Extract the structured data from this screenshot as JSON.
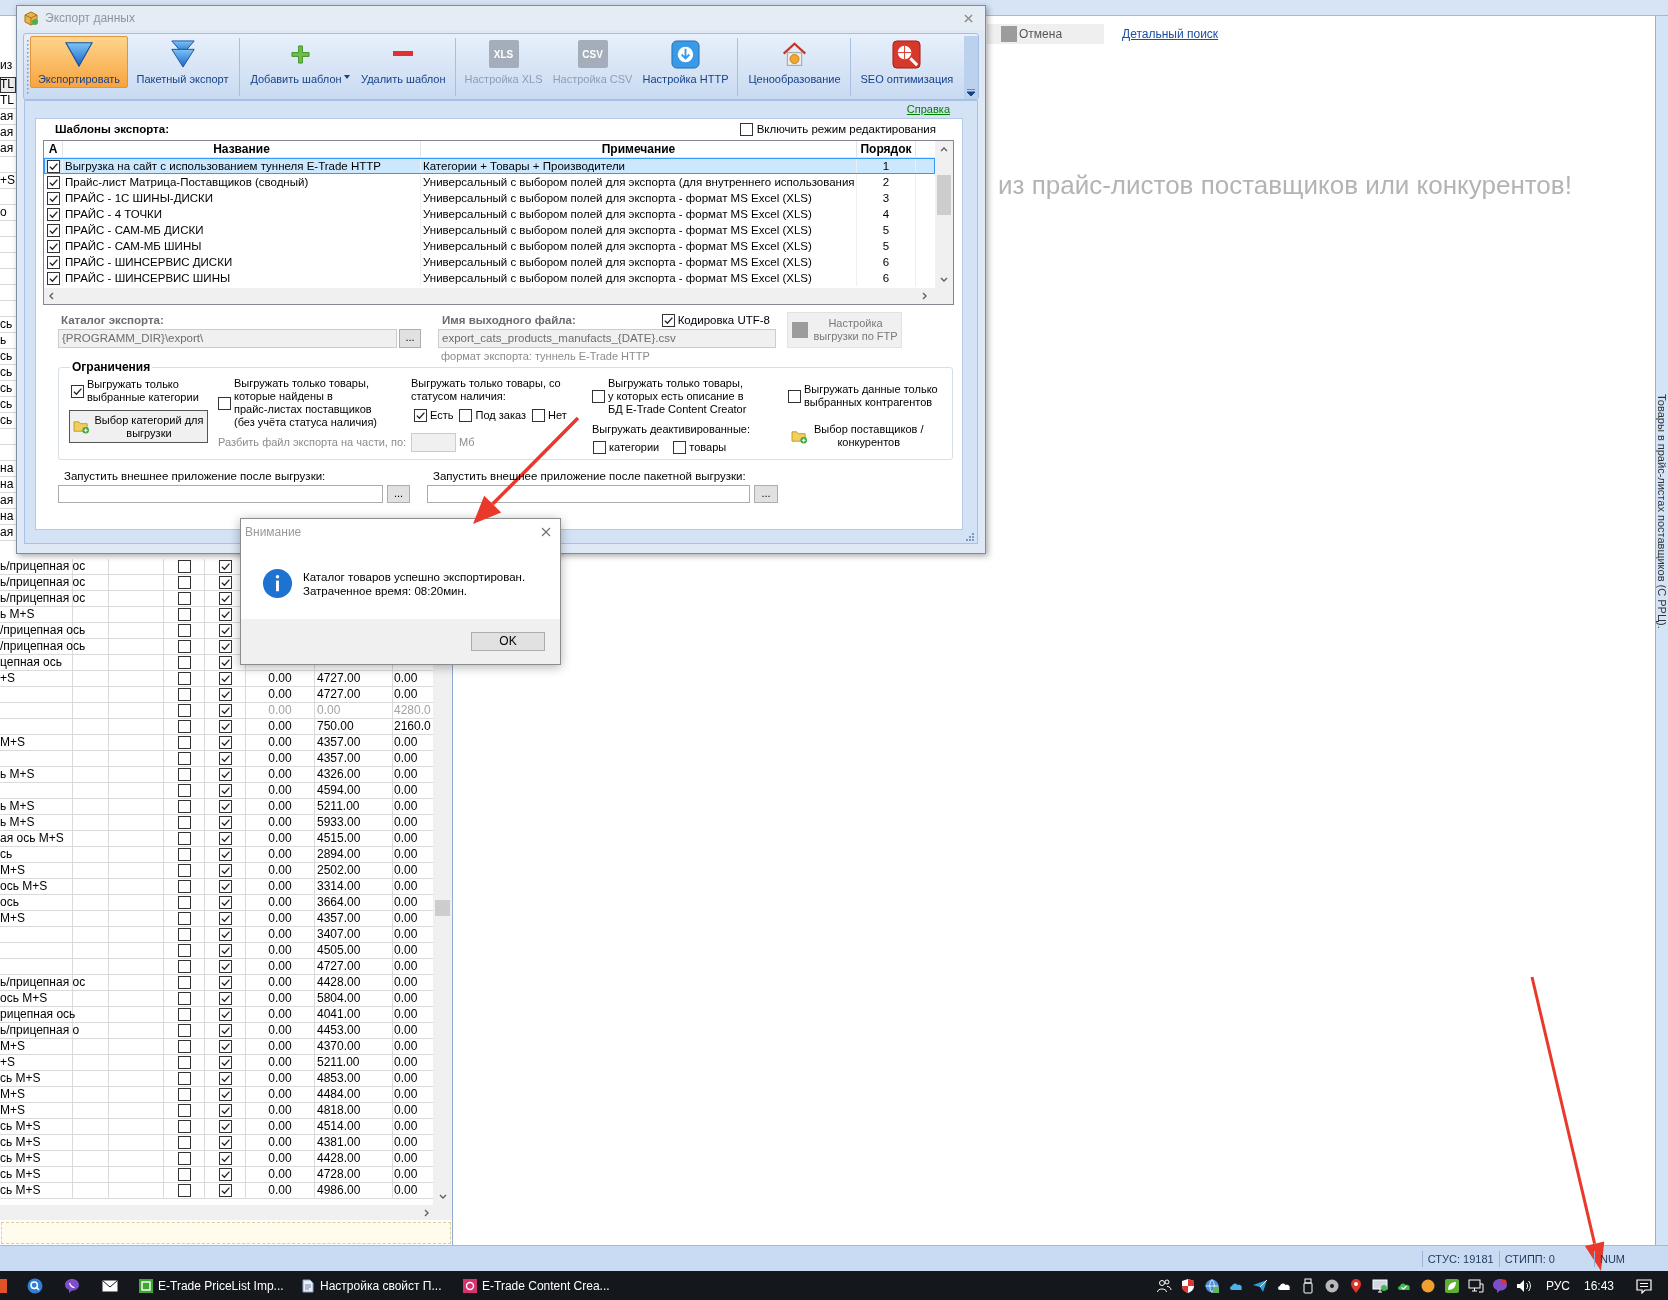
{
  "app": {
    "header_fragment": "из",
    "row_fragments": [
      {
        "column_1": "TL",
        "selected": true
      },
      {
        "column_1": "TL",
        "selected": false
      },
      {
        "column_1": "ая",
        "selected": false
      },
      {
        "column_1": "ая",
        "selected": false
      },
      {
        "column_1": "ая",
        "selected": false
      },
      {
        "selected": false
      },
      {
        "column_1": "+S",
        "selected": false
      },
      {
        "selected": false
      },
      {
        "column_1": "о",
        "selected": false
      },
      {
        "selected": false
      },
      {
        "selected": false
      },
      {
        "selected": false
      },
      {
        "selected": false
      },
      {
        "selected": false
      },
      {
        "selected": false
      },
      {
        "column_1": "сь",
        "selected": false
      },
      {
        "column_1": "ь",
        "selected": false
      },
      {
        "column_1": "сь",
        "selected": false
      },
      {
        "column_1": "сь",
        "selected": false
      },
      {
        "column_1": "сь",
        "selected": false
      },
      {
        "column_1": "сь",
        "selected": false
      },
      {
        "column_1": "сь",
        "selected": false
      },
      {
        "selected": false
      },
      {
        "selected": false
      },
      {
        "column_1": "на",
        "selected": false
      },
      {
        "column_1": "на",
        "selected": false
      },
      {
        "column_1": "ая",
        "selected": false
      },
      {
        "column_1": "на",
        "selected": false
      },
      {
        "column_1": "ая",
        "selected": false
      }
    ],
    "grid": {
      "rows": [
        {
          "column_1": "ь/прицепная ос",
          "checks": [
            false,
            true
          ],
          "disabled": false
        },
        {
          "column_1": "ь/прицепная ос",
          "checks": [
            false,
            true
          ],
          "disabled": false
        },
        {
          "column_1": "ь/прицепная ос",
          "checks": [
            false,
            true
          ],
          "disabled": false
        },
        {
          "column_1": "ь M+S",
          "checks": [
            false,
            true
          ],
          "disabled": false
        },
        {
          "column_1": "/прицепная ось",
          "checks": [
            false,
            true
          ],
          "disabled": false
        },
        {
          "column_1": "/прицепная ось",
          "checks": [
            false,
            true
          ],
          "disabled": false
        },
        {
          "column_1": "цепная ось",
          "checks": [
            false,
            true
          ],
          "disabled": false
        },
        {
          "column_1": "+S",
          "checks": [
            false,
            true
          ],
          "disabled": false,
          "values": [
            "0.00",
            "4727.00",
            "0.00"
          ]
        },
        {
          "checks": [
            false,
            true
          ],
          "disabled": false,
          "values": [
            "0.00",
            "4727.00",
            "0.00"
          ]
        },
        {
          "checks": [
            false,
            true
          ],
          "disabled": true,
          "values": [
            "0.00",
            "0.00",
            "4280.0"
          ]
        },
        {
          "checks": [
            false,
            true
          ],
          "disabled": false,
          "values": [
            "0.00",
            "750.00",
            "2160.0"
          ]
        },
        {
          "column_1": "M+S",
          "checks": [
            false,
            true
          ],
          "disabled": false,
          "values": [
            "0.00",
            "4357.00",
            "0.00"
          ]
        },
        {
          "checks": [
            false,
            true
          ],
          "disabled": false,
          "values": [
            "0.00",
            "4357.00",
            "0.00"
          ]
        },
        {
          "column_1": "ь M+S",
          "checks": [
            false,
            true
          ],
          "disabled": false,
          "values": [
            "0.00",
            "4326.00",
            "0.00"
          ]
        },
        {
          "checks": [
            false,
            true
          ],
          "disabled": false,
          "values": [
            "0.00",
            "4594.00",
            "0.00"
          ]
        },
        {
          "column_1": "ь M+S",
          "checks": [
            false,
            true
          ],
          "disabled": false,
          "values": [
            "0.00",
            "5211.00",
            "0.00"
          ]
        },
        {
          "column_1": "ь M+S",
          "checks": [
            false,
            true
          ],
          "disabled": false,
          "values": [
            "0.00",
            "5933.00",
            "0.00"
          ]
        },
        {
          "column_1": "ая ось M+S",
          "checks": [
            false,
            true
          ],
          "disabled": false,
          "values": [
            "0.00",
            "4515.00",
            "0.00"
          ]
        },
        {
          "column_1": "сь",
          "checks": [
            false,
            true
          ],
          "disabled": false,
          "values": [
            "0.00",
            "2894.00",
            "0.00"
          ]
        },
        {
          "column_1": "M+S",
          "checks": [
            false,
            true
          ],
          "disabled": false,
          "values": [
            "0.00",
            "2502.00",
            "0.00"
          ]
        },
        {
          "column_1": "ось M+S",
          "checks": [
            false,
            true
          ],
          "disabled": false,
          "values": [
            "0.00",
            "3314.00",
            "0.00"
          ]
        },
        {
          "column_1": "ось",
          "checks": [
            false,
            true
          ],
          "disabled": false,
          "values": [
            "0.00",
            "3664.00",
            "0.00"
          ]
        },
        {
          "column_1": "M+S",
          "checks": [
            false,
            true
          ],
          "disabled": false,
          "values": [
            "0.00",
            "4357.00",
            "0.00"
          ]
        },
        {
          "checks": [
            false,
            true
          ],
          "disabled": false,
          "values": [
            "0.00",
            "3407.00",
            "0.00"
          ]
        },
        {
          "checks": [
            false,
            true
          ],
          "disabled": false,
          "values": [
            "0.00",
            "4505.00",
            "0.00"
          ]
        },
        {
          "checks": [
            false,
            true
          ],
          "disabled": false,
          "values": [
            "0.00",
            "4727.00",
            "0.00"
          ]
        },
        {
          "column_1": "ь/прицепная ос",
          "checks": [
            false,
            true
          ],
          "disabled": false,
          "values": [
            "0.00",
            "4428.00",
            "0.00"
          ]
        },
        {
          "column_1": "ось M+S",
          "checks": [
            false,
            true
          ],
          "disabled": false,
          "values": [
            "0.00",
            "5804.00",
            "0.00"
          ]
        },
        {
          "column_1": "рицепная ось",
          "checks": [
            false,
            true
          ],
          "disabled": false,
          "values": [
            "0.00",
            "4041.00",
            "0.00"
          ]
        },
        {
          "column_1": "ь/прицепная о",
          "checks": [
            false,
            true
          ],
          "disabled": false,
          "values": [
            "0.00",
            "4453.00",
            "0.00"
          ]
        },
        {
          "column_1": "M+S",
          "checks": [
            false,
            true
          ],
          "disabled": false,
          "values": [
            "0.00",
            "4370.00",
            "0.00"
          ]
        },
        {
          "column_1": "+S",
          "checks": [
            false,
            true
          ],
          "disabled": false,
          "values": [
            "0.00",
            "5211.00",
            "0.00"
          ]
        },
        {
          "column_1": "сь M+S",
          "checks": [
            false,
            true
          ],
          "disabled": false,
          "values": [
            "0.00",
            "4853.00",
            "0.00"
          ]
        },
        {
          "column_1": "M+S",
          "checks": [
            false,
            true
          ],
          "disabled": false,
          "values": [
            "0.00",
            "4484.00",
            "0.00"
          ]
        },
        {
          "column_1": "M+S",
          "checks": [
            false,
            true
          ],
          "disabled": false,
          "values": [
            "0.00",
            "4818.00",
            "0.00"
          ]
        },
        {
          "column_1": "сь M+S",
          "checks": [
            false,
            true
          ],
          "disabled": false,
          "values": [
            "0.00",
            "4514.00",
            "0.00"
          ]
        },
        {
          "column_1": "сь M+S",
          "checks": [
            false,
            true
          ],
          "disabled": false,
          "values": [
            "0.00",
            "4381.00",
            "0.00"
          ]
        },
        {
          "column_1": "сь M+S",
          "checks": [
            false,
            true
          ],
          "disabled": false,
          "values": [
            "0.00",
            "4428.00",
            "0.00"
          ]
        },
        {
          "column_1": "сь M+S",
          "checks": [
            false,
            true
          ],
          "disabled": false,
          "values": [
            "0.00",
            "4728.00",
            "0.00"
          ]
        },
        {
          "column_1": "сь M+S",
          "checks": [
            false,
            true
          ],
          "disabled": false,
          "values": [
            "0.00",
            "4986.00",
            "0.00"
          ]
        }
      ]
    },
    "search_bar": {
      "cancel_button": "Отмена",
      "detail_search_link": "Детальный поиск"
    },
    "hint": "из прайс-листов поставщиков или конкурентов!",
    "side_tab": "Товары в прайс-листах поставщиков (С РРЦ).",
    "status_bar": [
      "СТУС: 19181",
      "СТИПП: 0",
      "NUM"
    ]
  },
  "export_dialog": {
    "title": "Экспорт данных",
    "toolbar": {
      "groups": [
        [
          {
            "kind": "export",
            "label": "Экспортировать",
            "selected": true,
            "disabled": false,
            "dropdown": false
          },
          {
            "kind": "batch",
            "label": "Пакетный экспорт",
            "selected": false,
            "disabled": false,
            "dropdown": false
          }
        ],
        [
          {
            "kind": "add",
            "label": "Добавить шаблон",
            "selected": false,
            "disabled": false,
            "dropdown": true
          },
          {
            "kind": "remove",
            "label": "Удалить шаблон",
            "selected": false,
            "disabled": false,
            "dropdown": false
          }
        ],
        [
          {
            "kind": "xls",
            "badge": "XLS",
            "label": "Настройка XLS",
            "selected": false,
            "disabled": true,
            "dropdown": false
          },
          {
            "kind": "csv",
            "badge": "CSV",
            "label": "Настройка CSV",
            "selected": false,
            "disabled": true,
            "dropdown": false
          },
          {
            "kind": "http",
            "label": "Настройка HTTP",
            "selected": false,
            "disabled": false,
            "dropdown": false
          }
        ],
        [
          {
            "kind": "pricing",
            "label": "Ценообразование",
            "selected": false,
            "disabled": false,
            "dropdown": false
          }
        ],
        [
          {
            "kind": "seo",
            "label": "SEO оптимизация",
            "selected": false,
            "disabled": false,
            "dropdown": false
          }
        ]
      ]
    },
    "help_link": "Справка",
    "templates": {
      "title": "Шаблоны экспорта:",
      "edit_mode": {
        "label": "Включить режим редактирования",
        "checked": false
      },
      "columns": [
        "A",
        "Название",
        "Примечание",
        "Порядок"
      ],
      "rows": [
        {
          "enabled": true,
          "name": "Выгрузка на сайт с использованием туннеля E-Trade HTTP",
          "note": "Категории + Товары + Производители",
          "order": "1",
          "selected": true
        },
        {
          "enabled": true,
          "name": "Прайс-лист Матрица-Поставщиков (сводный)",
          "note": "Универсальный с выбором полей для экспорта (для внутреннего использования",
          "order": "2",
          "selected": false
        },
        {
          "enabled": true,
          "name": "ПРАЙС - 1С ШИНЫ-ДИСКИ",
          "note": "Универсальный с выбором полей для экспорта - формат MS Excel (XLS)",
          "order": "3",
          "selected": false
        },
        {
          "enabled": true,
          "name": "ПРАЙС - 4 ТОЧКИ",
          "note": "Универсальный с выбором полей для экспорта - формат MS Excel (XLS)",
          "order": "4",
          "selected": false
        },
        {
          "enabled": true,
          "name": "ПРАЙС - САМ-МБ ДИСКИ",
          "note": "Универсальный с выбором полей для экспорта - формат MS Excel (XLS)",
          "order": "5",
          "selected": false
        },
        {
          "enabled": true,
          "name": "ПРАЙС - САМ-МБ ШИНЫ",
          "note": "Универсальный с выбором полей для экспорта - формат MS Excel (XLS)",
          "order": "5",
          "selected": false
        },
        {
          "enabled": true,
          "name": "ПРАЙС - ШИНСЕРВИС ДИСКИ",
          "note": "Универсальный с выбором полей для экспорта - формат MS Excel (XLS)",
          "order": "6",
          "selected": false
        },
        {
          "enabled": true,
          "name": "ПРАЙС - ШИНСЕРВИС ШИНЫ",
          "note": "Универсальный с выбором полей для экспорта - формат MS Excel (XLS)",
          "order": "6",
          "selected": false
        }
      ]
    },
    "catalog": {
      "label": "Каталог экспорта:",
      "value": "{PROGRAMM_DIR}\\export\\",
      "disabled": true,
      "browse": "..."
    },
    "output_file": {
      "label": "Имя выходного файла:",
      "utf8": {
        "label": "Кодировка UTF-8",
        "checked": true
      },
      "value": "export_cats_products_manufacts_{DATE}.csv",
      "disabled": true,
      "format_note": "формат экспорта: туннель E-Trade HTTP"
    },
    "ftp_button": {
      "label": "Настройка\nвыгрузки по FTP",
      "disabled": true
    },
    "restrictions": {
      "title": "Ограничения",
      "selected_categories": {
        "label": "Выгружать только\nвыбранные категории",
        "checked": true
      },
      "categories_button": "Выбор категорий для\nвыгрузки",
      "found_in_pricelists": {
        "label": "Выгружать только товары,\nкоторые найдены в\nпрайс-листах поставщиков\n(без учёта статуса наличия)",
        "checked": false
      },
      "split": {
        "label": "Разбить файл экспорта на части, по:",
        "unit": "Мб",
        "disabled": true
      },
      "availability": {
        "label": "Выгружать только товары, со\nстатусом наличия:",
        "options": [
          {
            "label": "Есть",
            "checked": true
          },
          {
            "label": "Под заказ",
            "checked": false
          },
          {
            "label": "Нет",
            "checked": false
          }
        ]
      },
      "with_description": {
        "label": "Выгружать только товары,\nу которых есть описание в\nБД E-Trade Content Creator",
        "checked": false
      },
      "deactivated": {
        "label": "Выгружать деактивированные:",
        "options": [
          {
            "label": "категории",
            "checked": false
          },
          {
            "label": "товары",
            "checked": false
          }
        ]
      },
      "selected_contractors": {
        "label": "Выгружать данные только\nвыбранных контрагентов",
        "checked": false
      },
      "suppliers_button": "Выбор поставщиков /\nконкурентов"
    },
    "launch_after_export": {
      "label": "Запустить внешнее приложение после выгрузки:",
      "browse": "..."
    },
    "launch_after_batch": {
      "label": "Запустить внешнее приложение после пакетной выгрузки:",
      "browse": "..."
    }
  },
  "message_box": {
    "title": "Внимание",
    "message": "Каталог товаров успешно экспортирован.\nЗатраченное время: 08:20мин.",
    "ok_button": "OK"
  },
  "taskbar": {
    "apps": [
      {
        "kind": "pricelist",
        "label": "E-Trade PriceList Imp..."
      },
      {
        "kind": "document",
        "label": "Настройка свойст П..."
      },
      {
        "kind": "content",
        "label": "E-Trade Content Crea..."
      }
    ],
    "language": "РУС",
    "time": "16:43"
  }
}
